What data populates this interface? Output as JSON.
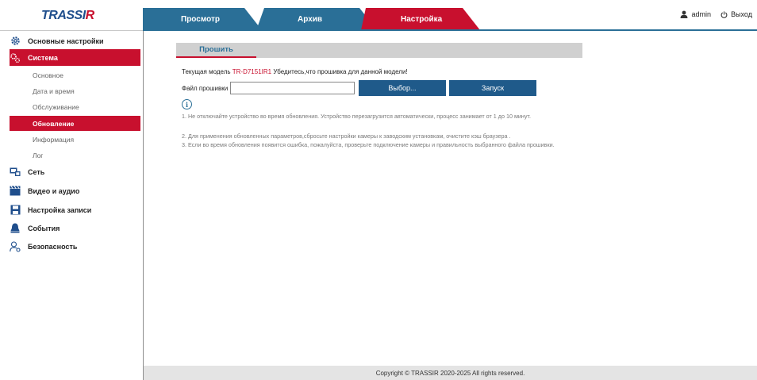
{
  "brand": {
    "logo_main": "TRASSI",
    "logo_accent": "R"
  },
  "header": {
    "tabs": [
      {
        "label": "Просмотр"
      },
      {
        "label": "Архив"
      },
      {
        "label": "Настройка"
      }
    ],
    "user": "admin",
    "logout": "Выход"
  },
  "sidebar": {
    "items": [
      {
        "label": "Основные настройки",
        "icon": "gear-icon"
      },
      {
        "label": "Система",
        "icon": "gears-icon",
        "active": true
      },
      {
        "label": "Сеть",
        "icon": "network-icon"
      },
      {
        "label": "Видео и аудио",
        "icon": "clapperboard-icon"
      },
      {
        "label": "Настройка записи",
        "icon": "floppy-icon"
      },
      {
        "label": "События",
        "icon": "alarm-icon"
      },
      {
        "label": "Безопасность",
        "icon": "user-lock-icon"
      }
    ],
    "subitems": [
      {
        "label": "Основное"
      },
      {
        "label": "Дата и время"
      },
      {
        "label": "Обслуживание"
      },
      {
        "label": "Обновление",
        "active": true
      },
      {
        "label": "Информация"
      },
      {
        "label": "Лог"
      }
    ]
  },
  "content": {
    "tab": "Прошить",
    "model_prefix": "Текущая модель ",
    "model": "TR-D7151IR1",
    "model_suffix": " Убедитесь,что прошивка для данной модели!",
    "file_label": "Файл прошивки",
    "file_value": "",
    "browse_button": "Выбор...",
    "start_button": "Запуск",
    "notes": [
      "1. Не отключайте устройство во время обновления. Устройство перезагрузится автоматически, процесс занимает от 1 до 10 минут.",
      "2. Для применения обновленных параметров,сбросьте настройки камеры к заводским установкам, очистите кэш браузера .",
      "3. Если во время обновления появится ошибка, пожалуйста, проверьте подключение камеры и правильность выбранного файла прошивки."
    ]
  },
  "footer": {
    "copyright": "Copyright © TRASSIR 2020-2025 All rights reserved."
  },
  "colors": {
    "accent": "#c8102e",
    "primary": "#2a6f97",
    "button": "#1f5a8a"
  }
}
